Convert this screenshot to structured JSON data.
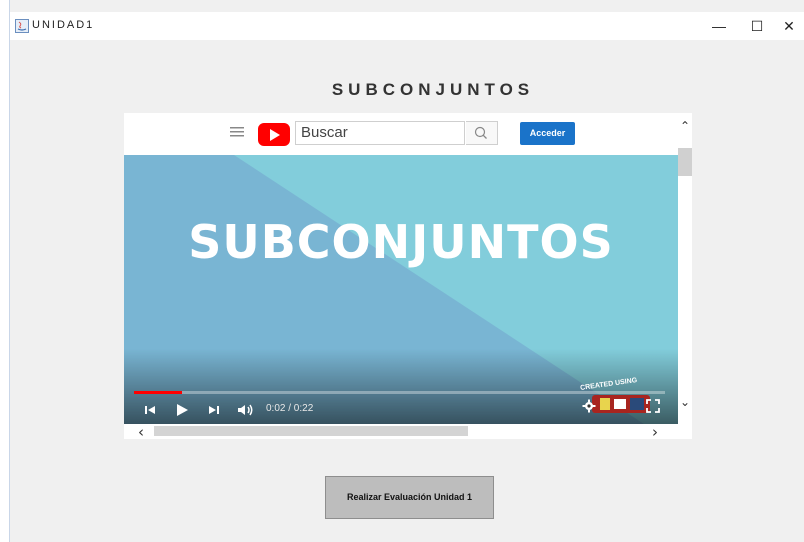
{
  "window": {
    "title": "UNIDAD1",
    "minimize_glyph": "—",
    "maximize_glyph": "☐",
    "close_glyph": "✕"
  },
  "page": {
    "heading": "SUBCONJUNTOS"
  },
  "youtube": {
    "search_value": "Buscar",
    "sign_in_label": "Acceder",
    "video": {
      "title_text": "SUBCONJUNTOS",
      "time_display": "0:02 / 0:22",
      "progress_fraction": 0.09,
      "watermark_caption": "CREATED USING"
    }
  },
  "scroll": {
    "up": "⌃",
    "down": "⌄",
    "left": "‹",
    "right": "›"
  },
  "actions": {
    "evaluation_label": "Realizar Evaluación Unidad 1"
  },
  "colors": {
    "youtube_red": "#ff0000",
    "button_blue": "#1a73c9",
    "video_bg": "#7fc9d8",
    "button_gray": "#bdbdbd"
  }
}
